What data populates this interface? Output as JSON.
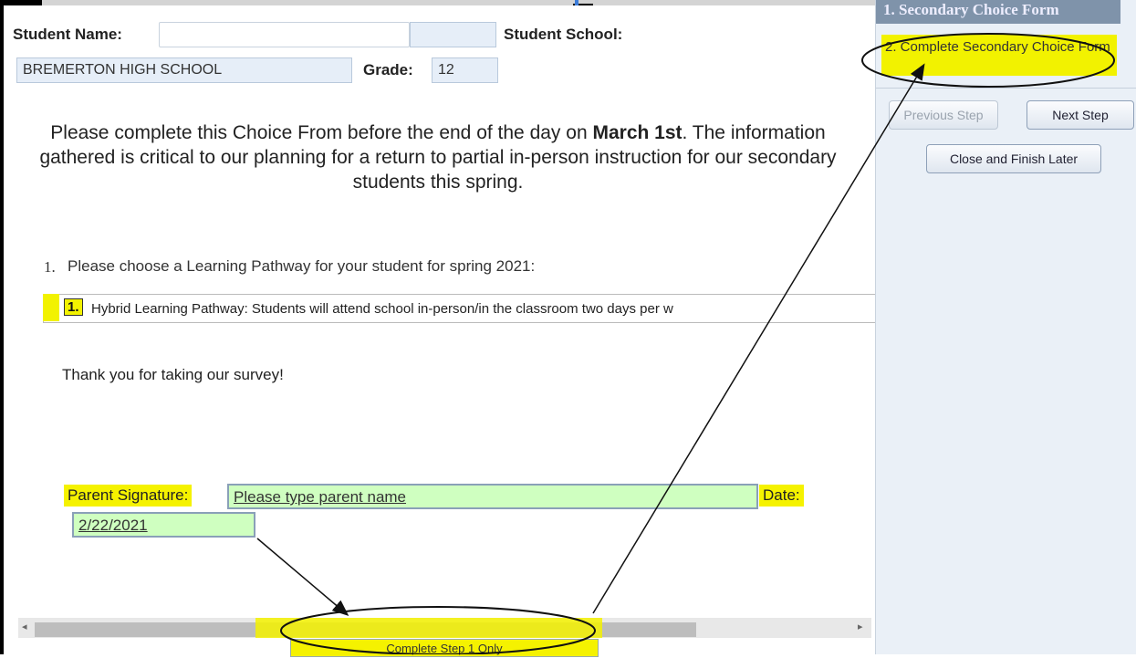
{
  "form": {
    "student_name_label": "Student Name:",
    "student_name_value": "",
    "student_school_label": "Student School:",
    "school_value": "BREMERTON HIGH SCHOOL",
    "grade_label": "Grade:",
    "grade_value": "12"
  },
  "intro": {
    "text_before": "Please complete this Choice From before the end of the day on ",
    "bold_date": "March 1st",
    "text_after": ". The information gathered is critical to our planning for a return to partial in-person instruction for our secondary students this spring."
  },
  "question": {
    "number": "1.",
    "text": "Please choose a Learning Pathway for your student for spring 2021:",
    "selected_option_number": "1.",
    "selected_option_text": "Hybrid Learning Pathway: Students will attend school in-person/in the classroom two days per w"
  },
  "thanks_text": "Thank you for taking our survey!",
  "signature": {
    "label": "Parent Signature",
    "colon": ":",
    "value": "Please type parent name",
    "date_label": "Date:",
    "date_value": "2/22/2021"
  },
  "submit_button": "Complete Step 1 Only",
  "sidebar": {
    "step1": "1. Secondary Choice Form",
    "step2": "2. Complete Secondary Choice Form",
    "previous_step": "Previous Step",
    "next_step": "Next Step",
    "close_finish_later": "Close and Finish Later"
  },
  "colors": {
    "highlight": "#f5f200",
    "input_green": "#cfffc0",
    "field_blue": "#e6eef8",
    "sidebar_bg": "#eaf0f7"
  }
}
